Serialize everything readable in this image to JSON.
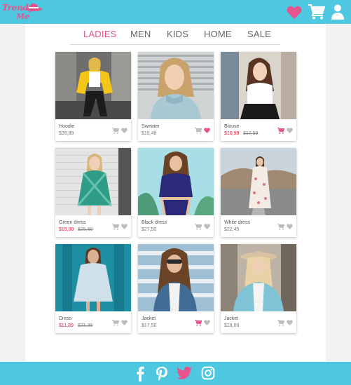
{
  "brand": {
    "line1": "Trendy",
    "line2": "Me"
  },
  "header": {
    "icons": [
      "heart-icon",
      "cart-icon",
      "user-icon"
    ]
  },
  "nav": {
    "tabs": [
      {
        "label": "LADIES",
        "active": true
      },
      {
        "label": "MEN",
        "active": false
      },
      {
        "label": "KIDS",
        "active": false
      },
      {
        "label": "HOME",
        "active": false
      },
      {
        "label": "SALE",
        "active": false
      }
    ]
  },
  "products": [
    {
      "name": "Hoodie",
      "price": "$28,89",
      "old_price": "",
      "on_sale": false,
      "in_cart": false,
      "liked": false
    },
    {
      "name": "Sweater",
      "price": "$15,49",
      "old_price": "",
      "on_sale": false,
      "in_cart": false,
      "liked": true
    },
    {
      "name": "Blouse",
      "price": "$10,99",
      "old_price": "$17,59",
      "on_sale": true,
      "in_cart": true,
      "liked": false
    },
    {
      "name": "Green dress",
      "price": "$15,00",
      "old_price": "$25,99",
      "on_sale": true,
      "in_cart": false,
      "liked": false
    },
    {
      "name": "Black dress",
      "price": "$27,50",
      "old_price": "",
      "on_sale": false,
      "in_cart": false,
      "liked": false
    },
    {
      "name": "White dress",
      "price": "$22,45",
      "old_price": "",
      "on_sale": false,
      "in_cart": false,
      "liked": false
    },
    {
      "name": "Dress",
      "price": "$11,89",
      "old_price": "$21,35",
      "on_sale": true,
      "in_cart": false,
      "liked": false
    },
    {
      "name": "Jacket",
      "price": "$17,50",
      "old_price": "",
      "on_sale": false,
      "in_cart": true,
      "liked": false
    },
    {
      "name": "Jacket",
      "price": "$18,00",
      "old_price": "",
      "on_sale": false,
      "in_cart": false,
      "liked": false
    }
  ],
  "footer": {
    "social": [
      "facebook-icon",
      "pinterest-icon",
      "twitter-icon",
      "instagram-icon"
    ]
  },
  "colors": {
    "accent": "#4dc8e0",
    "brand_pink": "#e8538e",
    "sale_red": "#d81b3a",
    "icon_grey": "#bdbdbd"
  }
}
